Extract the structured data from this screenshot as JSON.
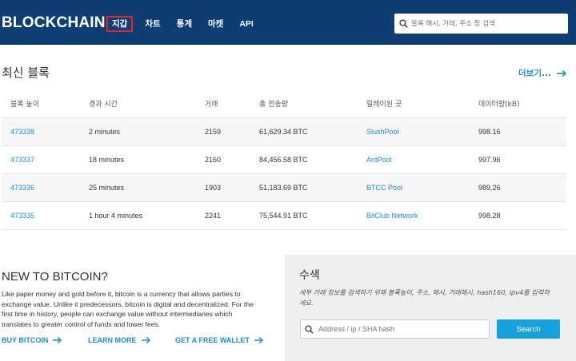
{
  "header": {
    "brand": "BLOCKCHAIN",
    "nav": [
      {
        "label": "지갑",
        "active": true
      },
      {
        "label": "차트"
      },
      {
        "label": "통계"
      },
      {
        "label": "마켓"
      },
      {
        "label": "API"
      }
    ],
    "search_placeholder": "블록 해시, 거래, 주소 등 검색"
  },
  "latest_blocks": {
    "title": "최신 블록",
    "more_label": "더보기...",
    "columns": [
      "블록 높이",
      "경과 시간",
      "거래",
      "총 전송량",
      "릴레이된 곳",
      "데이터량(kB)"
    ],
    "rows": [
      {
        "height": "473338",
        "age": "2 minutes",
        "txs": "2159",
        "sent": "61,629.34 BTC",
        "relayed": "SlushPool",
        "size": "998.16"
      },
      {
        "height": "473337",
        "age": "18 minutes",
        "txs": "2160",
        "sent": "84,456.58 BTC",
        "relayed": "AntPool",
        "size": "997.96"
      },
      {
        "height": "473336",
        "age": "25 minutes",
        "txs": "1903",
        "sent": "51,183.69 BTC",
        "relayed": "BTCC Pool",
        "size": "989.26"
      },
      {
        "height": "473335",
        "age": "1 hour 4 minutes",
        "txs": "2241",
        "sent": "75,544.91 BTC",
        "relayed": "BitClub Network",
        "size": "998.28"
      }
    ]
  },
  "intro": {
    "title": "NEW TO BITCOIN?",
    "text": "Like paper money and gold before it, bitcoin is a currency that allows parties to exchange value. Unlike it predecessors, bitcoin is digital and decentralized. For the first time in history, people can exchange value without intermediaries which translates to greater control of funds and lower fees.",
    "links": [
      "BUY BITCOIN",
      "LEARN MORE",
      "GET A FREE WALLET"
    ]
  },
  "search_panel": {
    "title": "수색",
    "description": "세부 거래 정보를 검색하기 위해 블록높이, 주소, 해시, 거래해시, hash160, ipv4를 입력하세요.",
    "placeholder": "Address / ip / SHA hash",
    "button_label": "Search"
  },
  "colors": {
    "header_bg": "#0e3e73",
    "link": "#1f8bc4",
    "button": "#16a2dd",
    "active_nav_border": "#e0262a"
  },
  "icons": [
    "search-icon",
    "arrow-right-icon"
  ]
}
